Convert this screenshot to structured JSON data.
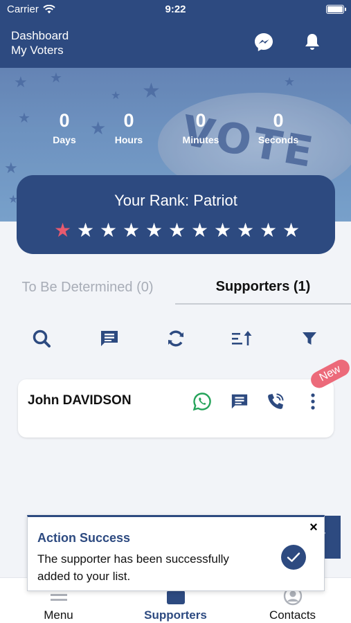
{
  "status_bar": {
    "carrier": "Carrier",
    "time": "9:22"
  },
  "header": {
    "title_line1": "Dashboard",
    "title_line2": "My Voters"
  },
  "hero": {
    "badge_text": "VOTE"
  },
  "countdown": [
    {
      "value": "0",
      "label": "Days"
    },
    {
      "value": "0",
      "label": "Hours"
    },
    {
      "value": "0",
      "label": "Minutes"
    },
    {
      "value": "0",
      "label": "Seconds"
    }
  ],
  "rank": {
    "title": "Your Rank: Patriot",
    "stars_total": 11,
    "stars_filled": 1,
    "star_color_active": "#e85a6e",
    "star_color": "#ffffff"
  },
  "tabs": [
    {
      "label": "To Be Determined (0)",
      "active": false
    },
    {
      "label": "Supporters (1)",
      "active": true
    }
  ],
  "toolbar": [
    "search-icon",
    "notes-icon",
    "refresh-icon",
    "sort-icon",
    "filter-icon"
  ],
  "supporter_card": {
    "name": "John DAVIDSON",
    "badge": "New"
  },
  "toast": {
    "title": "Action Success",
    "message": "The supporter has been successfully added to your list.",
    "close": "×"
  },
  "tab_bar": [
    {
      "label": "Menu",
      "icon": "menu-icon",
      "active": false
    },
    {
      "label": "Supporters",
      "icon": "supporters-icon",
      "active": true
    },
    {
      "label": "Contacts",
      "icon": "contacts-icon",
      "active": false
    }
  ],
  "colors": {
    "primary": "#2d4a80",
    "accent": "#ec6a7a",
    "whatsapp": "#25a35a"
  }
}
